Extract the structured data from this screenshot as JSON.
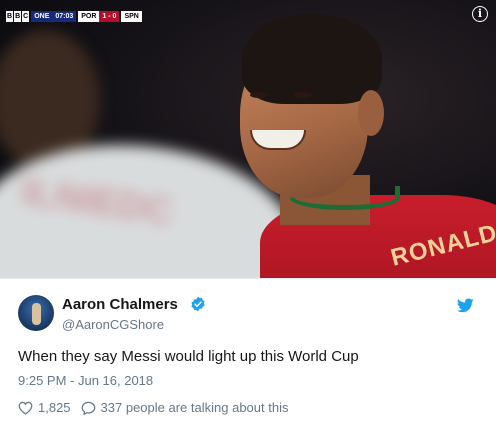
{
  "media": {
    "scoreboard": {
      "channel": [
        "B",
        "B",
        "C"
      ],
      "channel_suffix": "ONE",
      "clock": "07:03",
      "home": "POR",
      "score": "1 - 0",
      "away": "SPN"
    },
    "info_icon": "info-icon",
    "info_label": "i",
    "shirt_name": "RONALD",
    "blurred_shirt_text": "ILNIEDC"
  },
  "tweet": {
    "author_name": "Aaron Chalmers",
    "verified_icon": "verified-badge-icon",
    "handle": "@AaronCGShore",
    "platform_icon": "twitter-bird-icon",
    "text": "When they say Messi would light up this World Cup",
    "timestamp": "9:25 PM - Jun 16, 2018",
    "likes": "1,825",
    "like_icon": "heart-icon",
    "reply_icon": "comment-bubble-icon",
    "replies": "337 people are talking about this"
  },
  "colors": {
    "twitter_blue": "#1da1f2",
    "muted_text": "#657786",
    "main_text": "#14171a"
  }
}
